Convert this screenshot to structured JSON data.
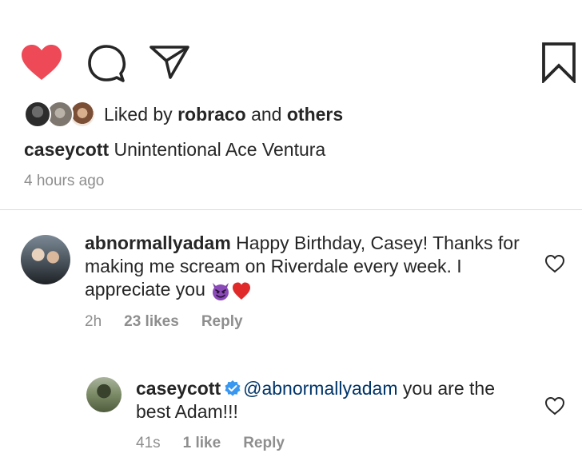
{
  "post": {
    "liked_by_prefix": "Liked by ",
    "liked_by_user": "robraco",
    "liked_by_and": " and ",
    "liked_by_others": "others",
    "caption_user": "caseycott",
    "caption_text": " Unintentional Ace Ventura",
    "timestamp": "4 hours ago"
  },
  "comments": [
    {
      "username": "abnormallyadam",
      "text": " Happy Birthday, Casey! Thanks for making me scream on Riverdale every week. I appreciate you ",
      "time": "2h",
      "likes": "23 likes",
      "reply_label": "Reply",
      "emojis": [
        "smiling-imp-icon",
        "red-heart-icon"
      ]
    },
    {
      "username": "caseycott",
      "verified": true,
      "mention": "@abnormallyadam",
      "text": " you are the best Adam!!!",
      "time": "41s",
      "likes": "1 like",
      "reply_label": "Reply"
    }
  ],
  "icons": {
    "like": "heart-filled-icon",
    "comment": "comment-bubble-icon",
    "share": "paper-plane-icon",
    "save": "bookmark-icon",
    "comment_like": "heart-outline-icon"
  },
  "colors": {
    "like_red": "#ed4956",
    "text": "#262626",
    "secondary": "#8e8e8e",
    "mention": "#003569",
    "verified_blue": "#3897f0"
  }
}
